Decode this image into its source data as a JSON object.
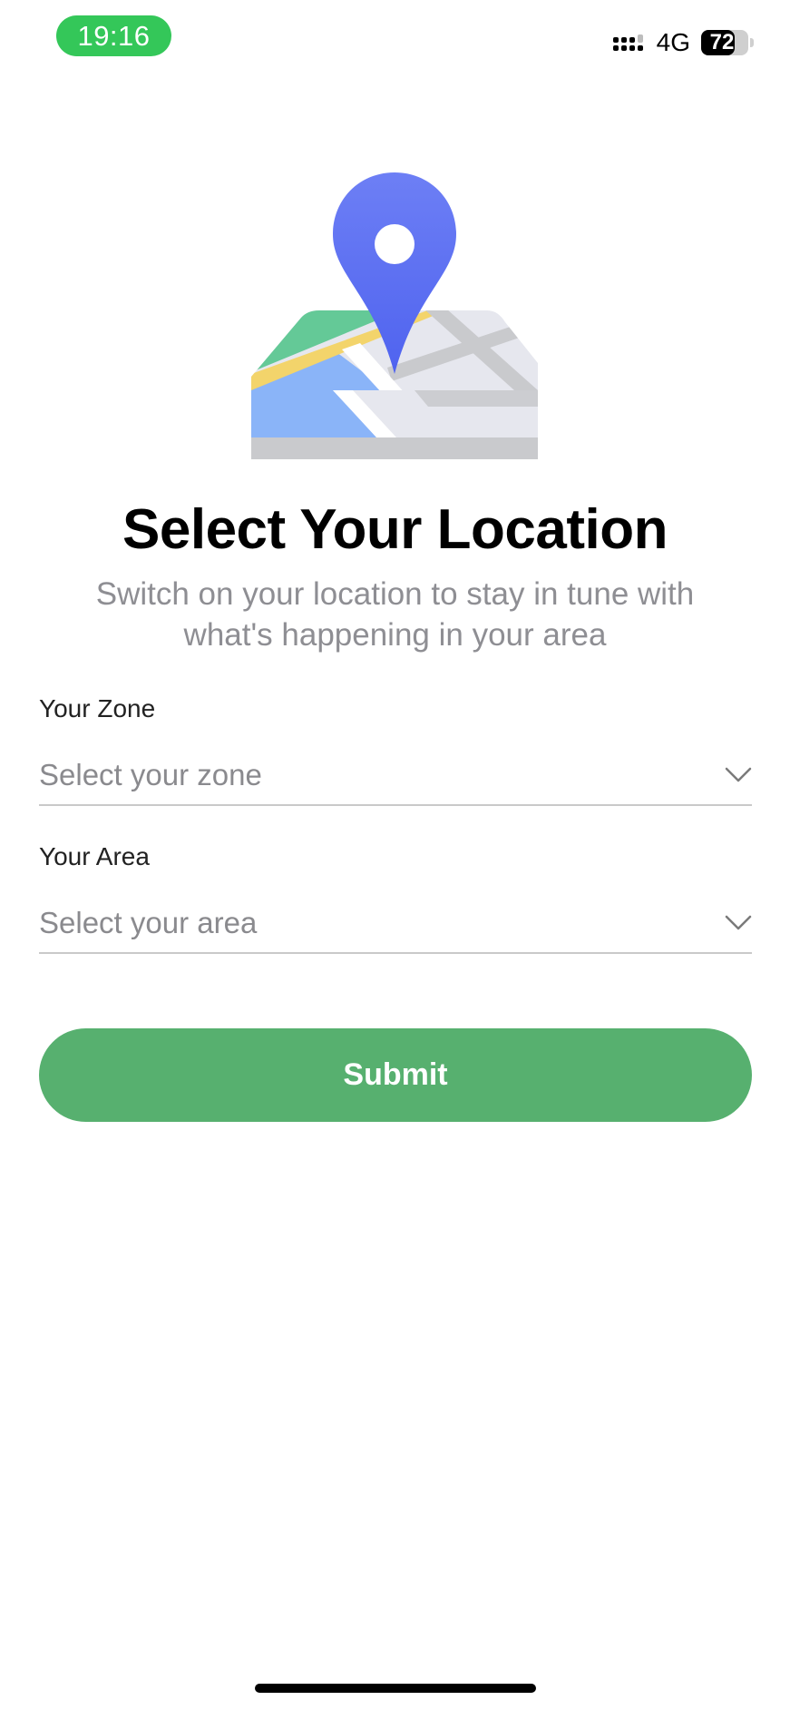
{
  "status_bar": {
    "time": "19:16",
    "network": "4G",
    "battery_level": "72",
    "battery_fraction": 0.72
  },
  "illustration": {
    "icon": "map-location-pin-icon",
    "colors": {
      "pin": "#5b6ff2",
      "park": "#64c997",
      "road": "#f3d46b",
      "water": "#8ab4f8",
      "land": "#e6e7ee",
      "base": "#c9cacd"
    }
  },
  "heading": {
    "title": "Select Your Location",
    "subtitle": "Switch on your location to stay in tune with what's happening in your area"
  },
  "form": {
    "zone": {
      "label": "Your Zone",
      "placeholder": "Select your zone",
      "icon": "chevron-down-icon"
    },
    "area": {
      "label": "Your Area",
      "placeholder": "Select your area",
      "icon": "chevron-down-icon"
    }
  },
  "submit": {
    "label": "Submit",
    "color": "#57b06f"
  }
}
